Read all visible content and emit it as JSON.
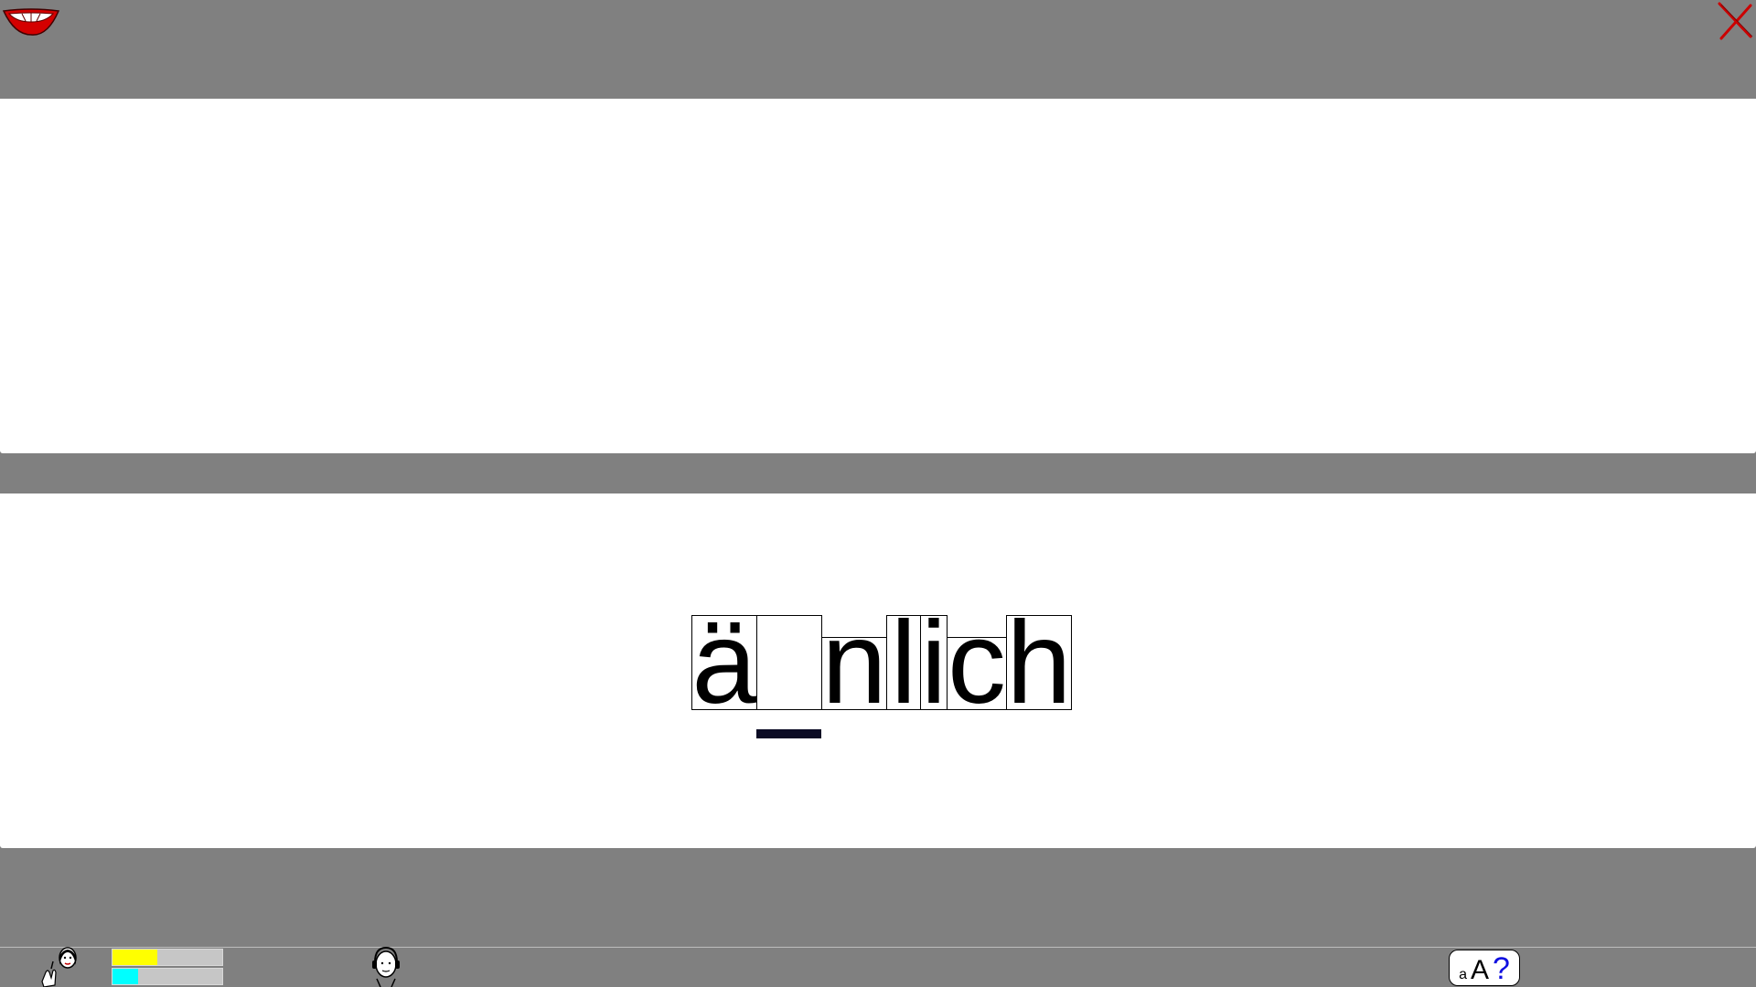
{
  "app": {
    "logo_icon": "mouth-logo-icon",
    "close_icon": "close-x-icon",
    "close_color": "#cc0000"
  },
  "exercise": {
    "letters": [
      {
        "char": "ä",
        "box": "tall"
      },
      {
        "char": "",
        "box": "tall",
        "is_gap": true
      },
      {
        "char": "n",
        "box": "short"
      },
      {
        "char": "l",
        "box": "tall"
      },
      {
        "char": "i",
        "box": "tall"
      },
      {
        "char": "c",
        "box": "short"
      },
      {
        "char": "h",
        "box": "tall"
      }
    ],
    "active_gap_index": 1
  },
  "status": {
    "teacher_icon": "teacher-pointing-icon",
    "progress": [
      {
        "color": "#ffff00",
        "value": 0.41
      },
      {
        "color": "#00ffff",
        "value": 0.23
      }
    ],
    "headset_icon": "headset-person-icon",
    "case_help": {
      "lower": "a",
      "upper": "A",
      "question": "?"
    }
  },
  "colors": {
    "background": "#808080",
    "panel": "#ffffff",
    "cursor": "#0b0b24",
    "help_question": "#1010e0"
  }
}
